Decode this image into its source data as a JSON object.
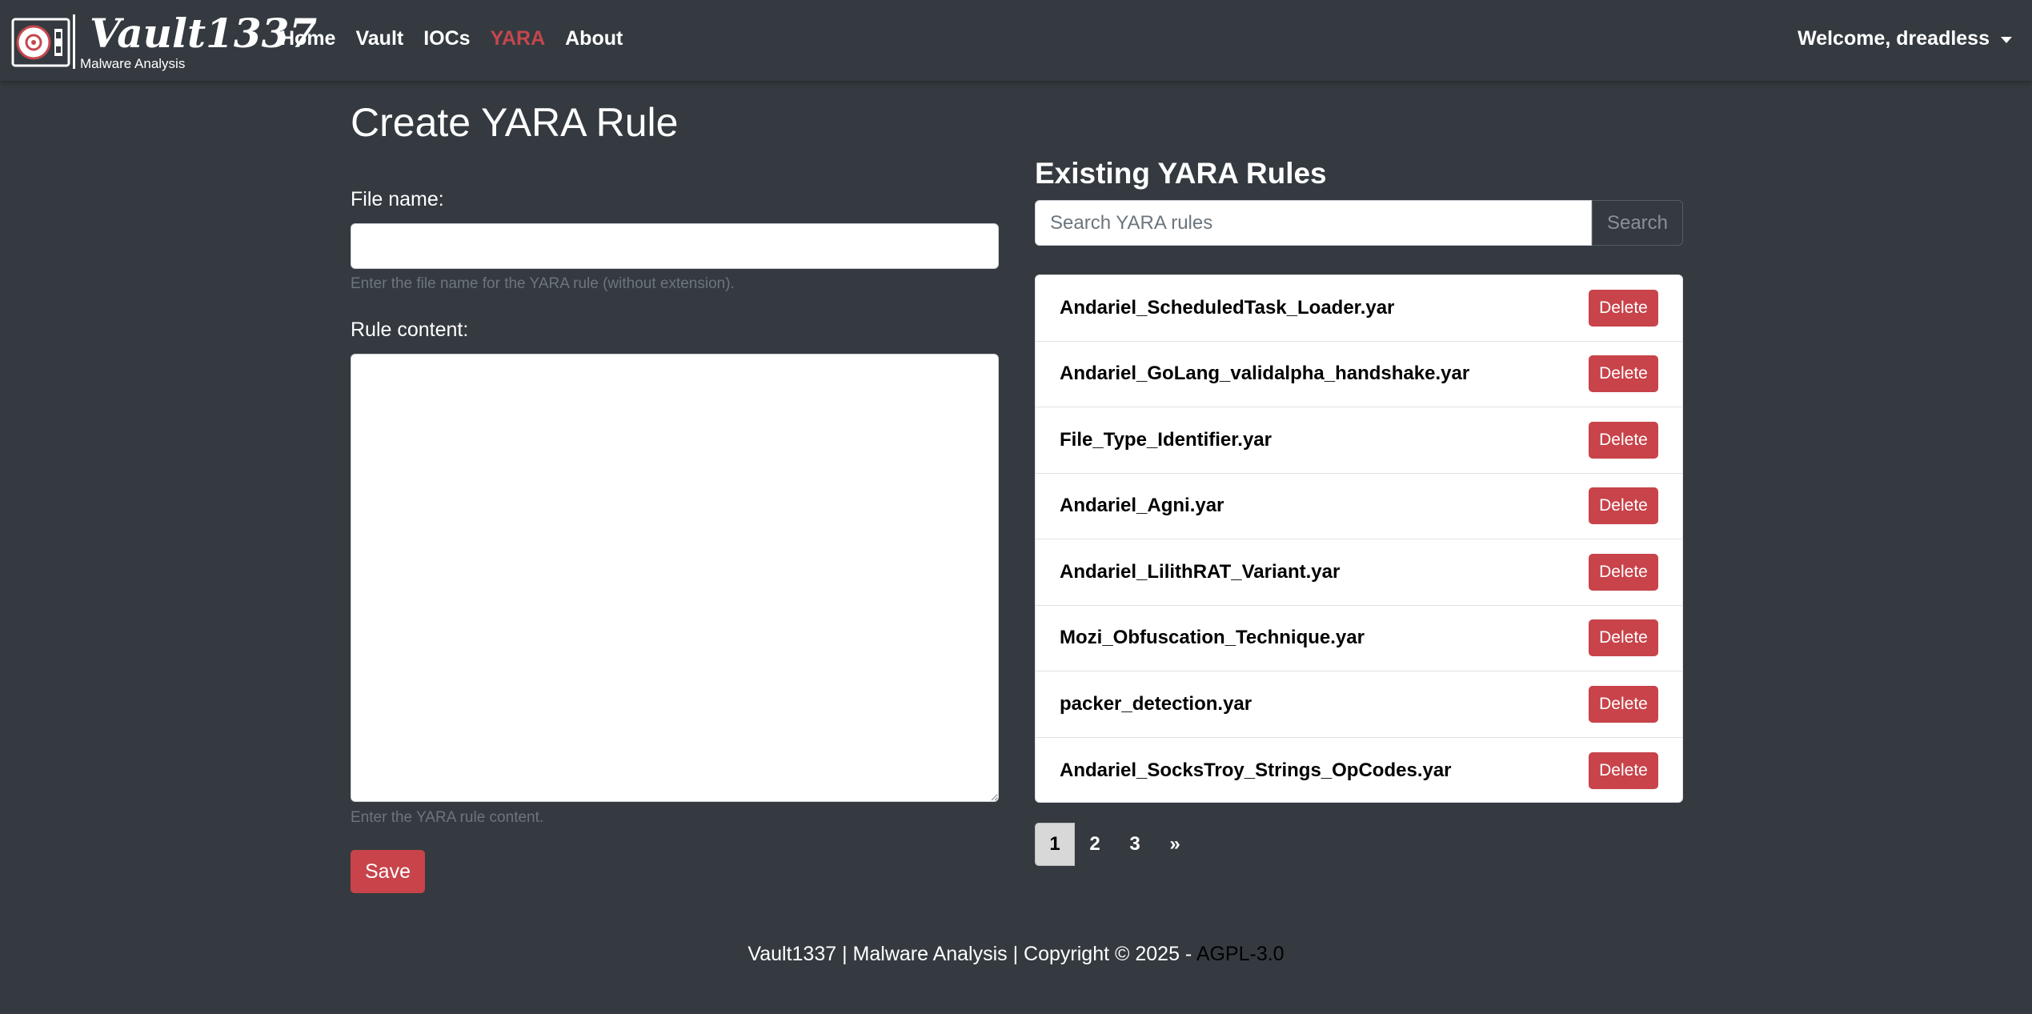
{
  "brand": {
    "title": "Vault1337",
    "subtitle": "Malware Analysis"
  },
  "nav": {
    "links": [
      {
        "label": "Home",
        "active": false
      },
      {
        "label": "Vault",
        "active": false
      },
      {
        "label": "IOCs",
        "active": false
      },
      {
        "label": "YARA",
        "active": true
      },
      {
        "label": "About",
        "active": false
      }
    ],
    "user_menu": "Welcome, dreadless",
    "active_color": "#c4474d"
  },
  "form": {
    "page_title": "Create YARA Rule",
    "file_name_label": "File name:",
    "file_name_value": "",
    "file_name_help": "Enter the file name for the YARA rule (without extension).",
    "rule_content_label": "Rule content:",
    "rule_content_value": "",
    "rule_content_help": "Enter the YARA rule content.",
    "save_label": "Save"
  },
  "rules": {
    "title": "Existing YARA Rules",
    "search_placeholder": "Search YARA rules",
    "search_button": "Search",
    "delete_label": "Delete",
    "items": [
      "Andariel_ScheduledTask_Loader.yar",
      "Andariel_GoLang_validalpha_handshake.yar",
      "File_Type_Identifier.yar",
      "Andariel_Agni.yar",
      "Andariel_LilithRAT_Variant.yar",
      "Mozi_Obfuscation_Technique.yar",
      "packer_detection.yar",
      "Andariel_SocksTroy_Strings_OpCodes.yar"
    ]
  },
  "pagination": {
    "pages": [
      "1",
      "2",
      "3"
    ],
    "current": "1",
    "next": "»"
  },
  "footer": {
    "text": "Vault1337 | Malware Analysis | Copyright © 2025 - ",
    "license": "AGPL-3.0"
  },
  "colors": {
    "background": "#343a40",
    "danger": "#c8434a"
  }
}
